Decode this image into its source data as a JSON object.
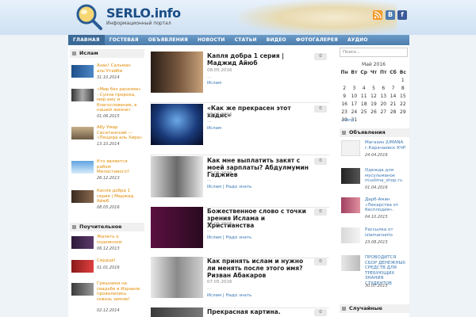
{
  "header": {
    "logo_title": "SERLO.info",
    "logo_subtitle": "Информационный портал",
    "social": {
      "rss": "",
      "vk": "B",
      "fb": "f"
    }
  },
  "nav": [
    "Главная",
    "Гостевая",
    "Объявления",
    "Новости",
    "Статьи",
    "Видео",
    "Фотогалерея",
    "Аудио"
  ],
  "left": {
    "section1": "Ислам",
    "items1": [
      {
        "title": "Азан! Сальман аль'Утайби",
        "date": "31.10.2014"
      },
      {
        "title": "«Мир без расизма» - Сунна пророка, мир ему и благословение, в нашей жизни»",
        "date": "01.06.2015"
      },
      {
        "title": "Абу Умар Сиситанский — «Пещера аль Хира»",
        "date": "13.10.2014"
      },
      {
        "title": "Кто является рабом Милостивого?",
        "date": "26.12.2013"
      },
      {
        "title": "Капля добра 1 серия | Маджид Айюб",
        "date": "08.05.2016"
      }
    ],
    "section2": "Поучительное",
    "items2": [
      {
        "title": "Жалеть о содеянном",
        "date": "06.12.2013"
      },
      {
        "title": "Сердце!",
        "date": "01.01.2016"
      },
      {
        "title": "Грешники на свадьбе в Израиле провалились сквозь землю!",
        "date": "02.12.2014"
      }
    ]
  },
  "posts": [
    {
      "title": "Капля добра 1 серия | Маджид Айюб",
      "date": "08.05.2016",
      "dots": "...",
      "cats": "Ислам",
      "comments": "0"
    },
    {
      "title": "«Как же прекрасен этот хадис»",
      "date": "07.05.2016",
      "dots": "...",
      "cats": "Ислам",
      "comments": "0"
    },
    {
      "title": "Как мне выплатить закят с моей зарплаты? Абдулмумин Гаджиев",
      "date": "07.05.2016",
      "dots": "...",
      "cats": "Ислам | Надо знать",
      "comments": "0"
    },
    {
      "title": "Божественное слово с точки зрения Ислама и Христианства",
      "date": "07.05.2016",
      "dots": "...",
      "cats": "Ислам | Надо знать",
      "comments": "0"
    },
    {
      "title": "Как принять ислам и нужно ли менять после этого имя? Ризван Абакаров",
      "date": "07.05.2016",
      "dots": "...",
      "cats": "Ислам | Надо знать",
      "comments": "0"
    },
    {
      "title": "Прекрасная картина.",
      "date": "",
      "dots": "",
      "cats": "",
      "comments": "0"
    }
  ],
  "right": {
    "search_placeholder": "Поиск...",
    "calendar_title": "Май 2016",
    "weekdays": [
      "Пн",
      "Вт",
      "Ср",
      "Чт",
      "Пт",
      "Сб",
      "Вс"
    ],
    "weeks": [
      [
        "",
        "",
        "",
        "",
        "",
        "",
        "1"
      ],
      [
        "2",
        "3",
        "4",
        "5",
        "6",
        "7",
        "8"
      ],
      [
        "9",
        "10",
        "11",
        "12",
        "13",
        "14",
        "15"
      ],
      [
        "16",
        "17",
        "18",
        "19",
        "20",
        "21",
        "22"
      ],
      [
        "23",
        "24",
        "25",
        "26",
        "27",
        "28",
        "29"
      ],
      [
        "30",
        "31",
        "",
        "",
        "",
        "",
        ""
      ]
    ],
    "prev_link": "« Апр",
    "ads_title": "Объявления",
    "ads": [
      {
        "title": "Магазин JUMANA г.Карачаевск КЧР",
        "date": "24.04.2016"
      },
      {
        "title": "Одежда для мусульманок muslima_shop.ru",
        "date": "01.04.2016"
      },
      {
        "title": "Дарб-Амин «Лекарства от бесплодия».",
        "date": "04.10.2015"
      },
      {
        "title": "Рассылка от islamanserlo",
        "date": "23.08.2015"
      },
      {
        "title": "ПРОВОДИТСЯ СБОР ДЕНЕЖНЫХ СРЕДСТВ ДЛЯ ТРЕБУЮЩИХ ЗНАНИЯ СТУДЕНТОВ",
        "date": "30.07.2015"
      }
    ],
    "random_title": "Случайные"
  }
}
